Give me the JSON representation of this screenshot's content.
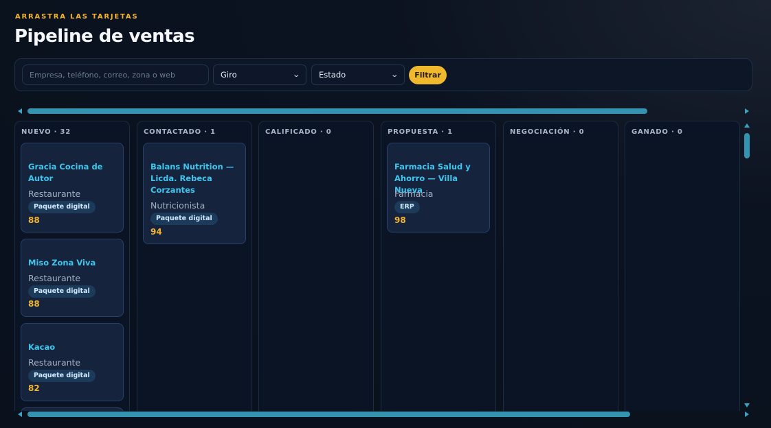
{
  "header": {
    "eyebrow": "ARRASTRA LAS TARJETAS",
    "title": "Pipeline de ventas"
  },
  "filters": {
    "search_placeholder": "Empresa, teléfono, correo, zona o web",
    "giro_label": "Giro",
    "estado_label": "Estado",
    "filter_button": "Filtrar"
  },
  "colors": {
    "accent": "#f0b82d",
    "card_title": "#3fc6ef",
    "scrollbar": "#3393b0"
  },
  "columns": [
    {
      "header": "NUEVO · 32",
      "cards": [
        {
          "name": "Gracia Cocina de Autor",
          "type": "Restaurante",
          "tag": "Paquete digital",
          "score": "88"
        },
        {
          "name": "Miso Zona Viva",
          "type": "Restaurante",
          "tag": "Paquete digital",
          "score": "88"
        },
        {
          "name": "Kacao",
          "type": "Restaurante",
          "tag": "Paquete digital",
          "score": "82"
        }
      ]
    },
    {
      "header": "CONTACTADO · 1",
      "cards": [
        {
          "name": "Balans Nutrition — Licda. Rebeca Corzantes",
          "type": "Nutricionista",
          "tag": "Paquete digital",
          "score": "94"
        }
      ]
    },
    {
      "header": "CALIFICADO · 0",
      "cards": []
    },
    {
      "header": "PROPUESTA · 1",
      "cards": [
        {
          "name": "Farmacia Salud y Ahorro — Villa Nueva",
          "type": "Farmacia",
          "tag": "ERP",
          "score": "98"
        }
      ]
    },
    {
      "header": "NEGOCIACIÓN · 0",
      "cards": []
    },
    {
      "header": "GANADO · 0",
      "cards": []
    }
  ]
}
